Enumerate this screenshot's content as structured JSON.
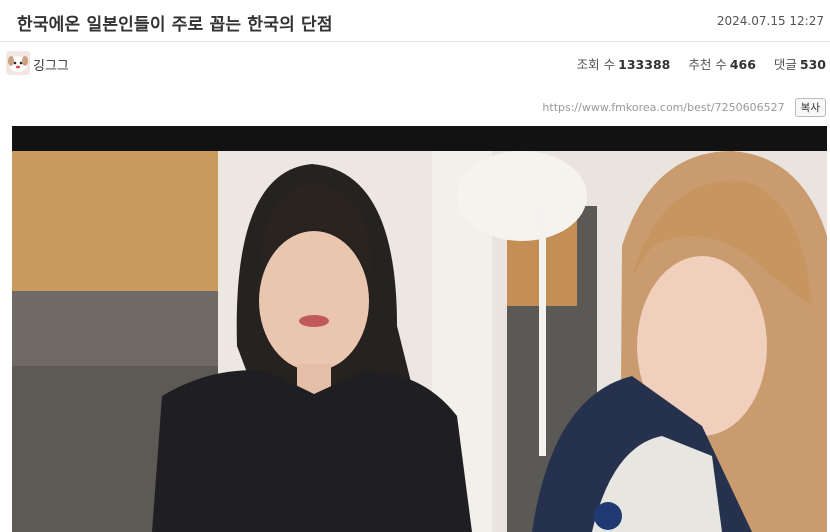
{
  "post": {
    "title": "한국에온 일본인들이 주로 꼽는 한국의 단점",
    "date": "2024.07.15  12:27",
    "author": "깅그그",
    "stats": {
      "views_label": "조회 수",
      "views": "133388",
      "recommend_label": "추천 수",
      "recommend": "466",
      "comments_label": "댓글",
      "comments": "530"
    },
    "url": "https://www.fmkorea.com/best/7250606527",
    "copy_label": "복사"
  },
  "icons": {
    "avatar": "puppy-avatar-icon"
  },
  "colors": {
    "title": "#333333",
    "stat_value": "#333333",
    "url": "#999999"
  }
}
